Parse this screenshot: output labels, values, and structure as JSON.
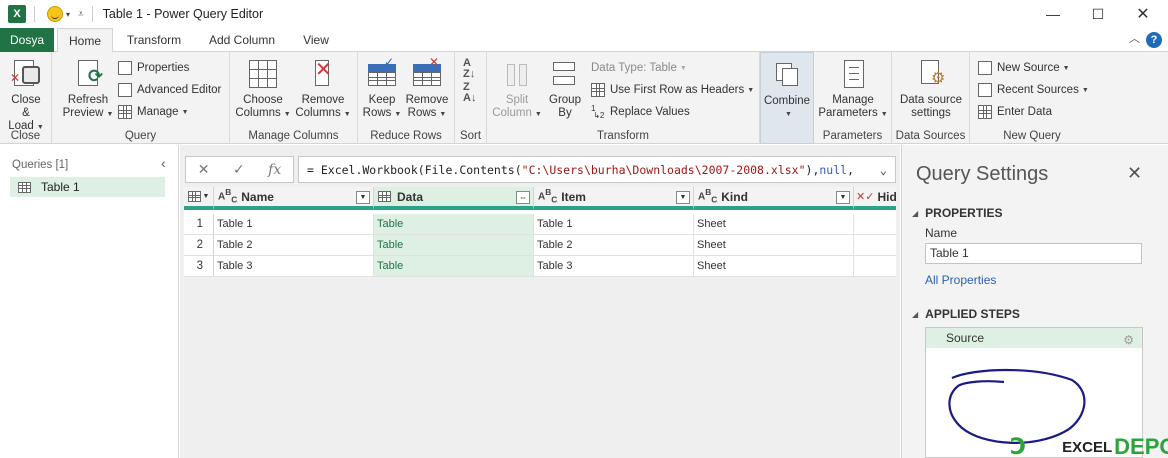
{
  "window": {
    "title": "Table 1 - Power Query Editor",
    "logo": "X"
  },
  "tabs": {
    "file": "Dosya",
    "items": [
      "Home",
      "Transform",
      "Add Column",
      "View"
    ],
    "active": "Home",
    "help": "?"
  },
  "ribbon": {
    "close": {
      "close_load": [
        "Close &",
        "Load"
      ],
      "label": "Close"
    },
    "query": {
      "refresh": [
        "Refresh",
        "Preview"
      ],
      "properties": "Properties",
      "advanced_editor": "Advanced Editor",
      "manage": "Manage",
      "label": "Query"
    },
    "manage_columns": {
      "choose": [
        "Choose",
        "Columns"
      ],
      "remove": [
        "Remove",
        "Columns"
      ],
      "label": "Manage Columns"
    },
    "reduce_rows": {
      "keep": [
        "Keep",
        "Rows"
      ],
      "remove": [
        "Remove",
        "Rows"
      ],
      "label": "Reduce Rows"
    },
    "sort": {
      "label": "Sort"
    },
    "transform": {
      "split": [
        "Split",
        "Column"
      ],
      "group": [
        "Group",
        "By"
      ],
      "data_type": "Data Type: Table",
      "first_row": "Use First Row as Headers",
      "replace": "Replace Values",
      "label": "Transform"
    },
    "combine": {
      "btn": "Combine"
    },
    "parameters": {
      "manage": [
        "Manage",
        "Parameters"
      ],
      "label": "Parameters"
    },
    "data_sources": {
      "settings": [
        "Data source",
        "settings"
      ],
      "label": "Data Sources"
    },
    "new_query": {
      "new_source": "New Source",
      "recent": "Recent Sources",
      "enter": "Enter Data",
      "label": "New Query"
    }
  },
  "queries": {
    "header": "Queries [1]",
    "items": [
      "Table 1"
    ]
  },
  "formula": {
    "prefix": "= Excel.Workbook(File.Contents(",
    "path": "\"C:\\Users\\burha\\Downloads\\2007-2008.xlsx\"",
    "mid": "), ",
    "null": "null",
    "tail": ","
  },
  "grid": {
    "columns": [
      "Name",
      "Data",
      "Item",
      "Kind",
      "Hidd"
    ],
    "rows": [
      [
        "Table 1",
        "Table",
        "Table 1",
        "Sheet"
      ],
      [
        "Table 2",
        "Table",
        "Table 2",
        "Sheet"
      ],
      [
        "Table 3",
        "Table",
        "Table 3",
        "Sheet"
      ]
    ]
  },
  "settings": {
    "title": "Query Settings",
    "properties": "PROPERTIES",
    "name_label": "Name",
    "name_value": "Table 1",
    "all_props": "All Properties",
    "applied_steps": "APPLIED STEPS",
    "steps": [
      "Source"
    ]
  },
  "watermark": {
    "left": "EXCEL",
    "right": "DEPO"
  }
}
